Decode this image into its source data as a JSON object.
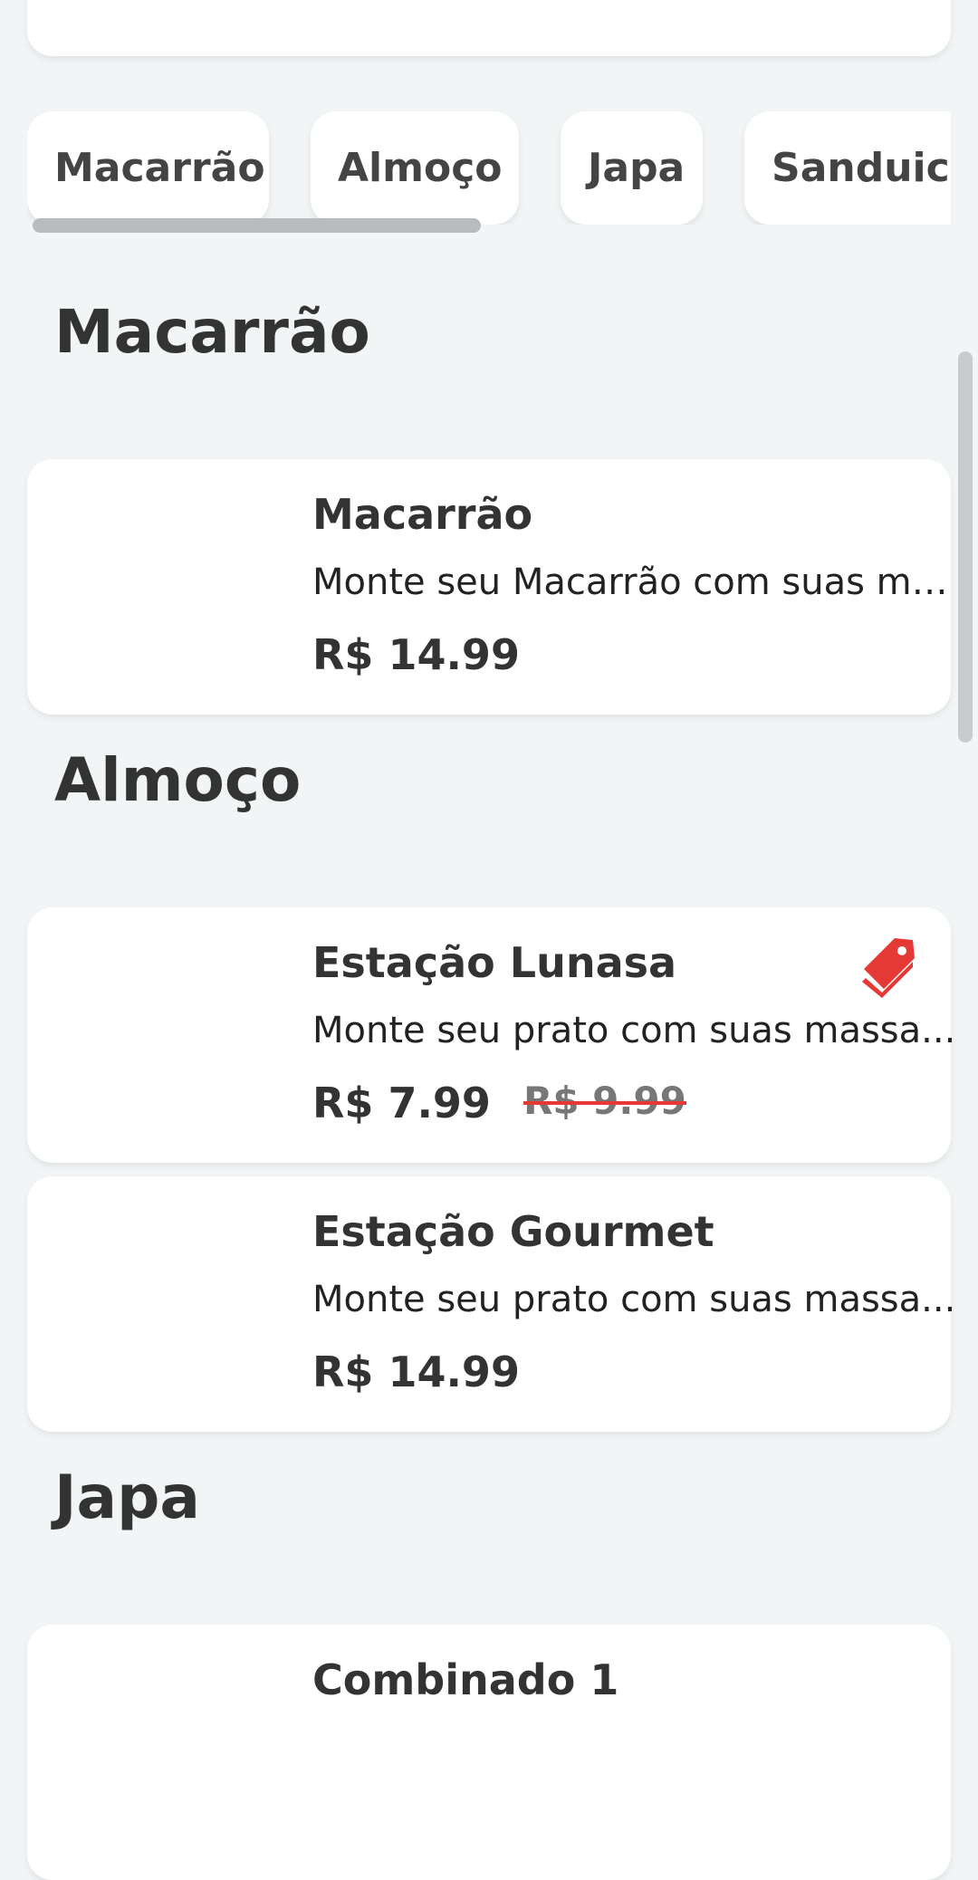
{
  "categories": [
    {
      "label": "Macarrão"
    },
    {
      "label": "Almoço"
    },
    {
      "label": "Japa"
    },
    {
      "label": "Sanduich"
    }
  ],
  "sections": [
    {
      "title": "Macarrão",
      "items": [
        {
          "name": "Macarrão",
          "description": "Monte seu Macarrão com suas ma...",
          "price": "R$ 14.99"
        }
      ]
    },
    {
      "title": "Almoço",
      "items": [
        {
          "name": "Estação Lunasa",
          "description": "Monte seu prato com suas massa...",
          "price": "R$ 7.99",
          "old_price": "R$ 9.99",
          "promo_icon": "tag-icon"
        },
        {
          "name": "Estação Gourmet",
          "description": "Monte seu prato com suas massa...",
          "price": "R$ 14.99"
        }
      ]
    },
    {
      "title": "Japa",
      "items": [
        {
          "name": "Combinado 1"
        }
      ]
    }
  ],
  "colors": {
    "background": "#f2f5f6",
    "card": "#ffffff",
    "text": "#333333",
    "promo": "#e53935"
  }
}
